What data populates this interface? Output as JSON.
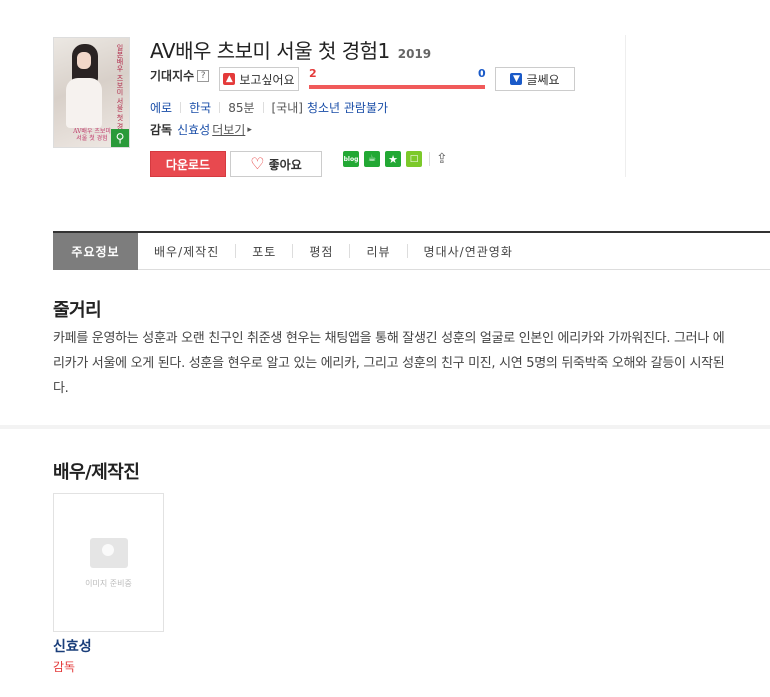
{
  "movie": {
    "title": "AV배우 츠보미 서울 첫 경험1",
    "year": "2019",
    "poster_pink_text": "AV배우 츠보미\n서울 첫 경험",
    "poster_vertical_text": "일본배우 츠보미 서울 첫 경험"
  },
  "expect": {
    "label": "기대지수",
    "help": "?",
    "want_label": "보고싶어요",
    "notwant_label": "글쎄요",
    "want_count": "2",
    "notwant_count": "0",
    "want_ratio": 1.0
  },
  "meta": {
    "genre": "에로",
    "country": "한국",
    "runtime": "85분",
    "rating_prefix": "[국내]",
    "rating": "청소년 관람불가"
  },
  "director": {
    "label": "감독",
    "name": "신효성",
    "more": "더보기"
  },
  "buttons": {
    "download": "다운로드",
    "like": "좋아요"
  },
  "share": {
    "blog": "blog",
    "cafe": "☕",
    "star": "★",
    "memo": "□",
    "share_arrow": "⇪"
  },
  "tabs": [
    "주요정보",
    "배우/제작진",
    "포토",
    "평점",
    "리뷰",
    "명대사/연관영화"
  ],
  "plot": {
    "heading": "줄거리",
    "text": "카페를 운영하는 성훈과 오랜 친구인 취준생 현우는 채팅앱을 통해 잘생긴 성훈의 얼굴로 인본인 에리카와 가까워진다. 그러나 에리카가 서울에 오게 된다. 성훈을 현우로 알고 있는 에리카, 그리고 성훈의 친구 미진, 시연 5명의 뒤죽박죽 오해와 갈등이 시작된다."
  },
  "cast": {
    "heading": "배우/제작진",
    "placeholder": "이미지 준비중",
    "members": [
      {
        "name": "신효성",
        "role": "감독"
      }
    ]
  }
}
